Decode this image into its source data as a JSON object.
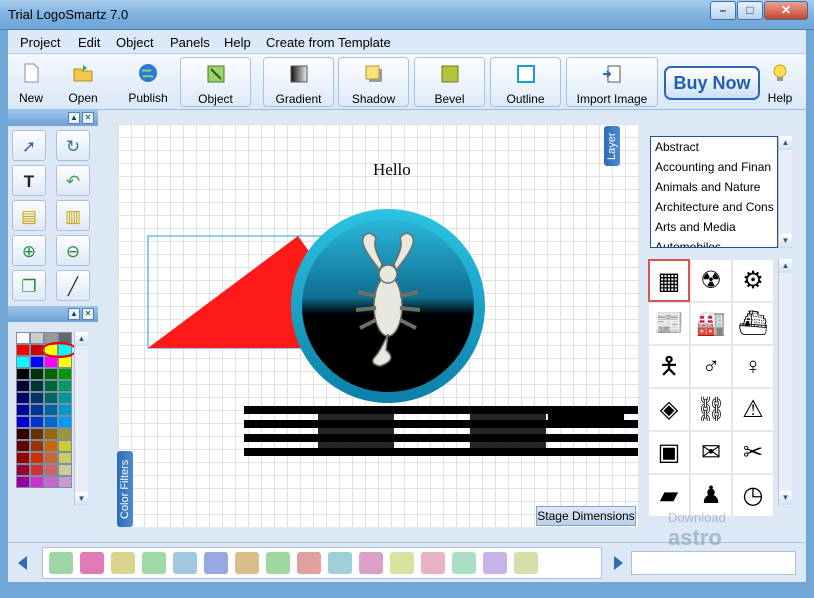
{
  "window": {
    "title": "Trial LogoSmartz 7.0",
    "buttons": [
      "–",
      "□",
      "✕"
    ]
  },
  "menu": [
    "Project",
    "Edit",
    "Object",
    "Panels",
    "Help",
    "Create from Template"
  ],
  "toolbar": {
    "new": "New",
    "open": "Open",
    "publish": "Publish",
    "object": "Object",
    "gradient": "Gradient",
    "shadow": "Shadow",
    "bevel": "Bevel",
    "outline": "Outline",
    "import_image": "Import Image",
    "buy_now": "Buy Now",
    "help": "Help"
  },
  "left_tools": [
    "select-arrow",
    "redo",
    "text",
    "undo",
    "bring-front",
    "send-back",
    "zoom-in",
    "zoom-out",
    "copy",
    "line"
  ],
  "canvas": {
    "hello": "Hello",
    "tabs": {
      "layer": "Layer",
      "color_filters": "Color Filters",
      "stage_dimensions": "Stage Dimensions"
    }
  },
  "categories": [
    "Abstract",
    "Accounting and Finan",
    "Animals and Nature",
    "Architecture and Cons",
    "Arts and Media",
    "Automobiles"
  ],
  "watermark": {
    "line1": "Download",
    "line2": "astro"
  },
  "colors": {
    "accent": "#2e6bb6",
    "triangle": "#ff1a1a",
    "badge_outer": "#18a9c9",
    "palette": [
      "#ffffff",
      "#cccccc",
      "#999999",
      "#666666",
      "#ff0000",
      "#cc0000",
      "#ffff00",
      "#00ffff",
      "#00ffff",
      "#0000ff",
      "#ff00ff",
      "#ffff00",
      "#000000",
      "#003300",
      "#006600",
      "#009900",
      "#000033",
      "#003333",
      "#006633",
      "#009966",
      "#000066",
      "#003366",
      "#006666",
      "#009999",
      "#000099",
      "#003399",
      "#006699",
      "#0099cc",
      "#0000cc",
      "#0033cc",
      "#0066cc",
      "#0099ff",
      "#330000",
      "#663300",
      "#996600",
      "#999933",
      "#660000",
      "#993300",
      "#cc6600",
      "#cccc33",
      "#990000",
      "#cc3300",
      "#cc6633",
      "#cccc66",
      "#990033",
      "#cc3333",
      "#cc6666",
      "#cccc99",
      "#990099",
      "#cc33cc",
      "#cc66cc",
      "#cc99cc"
    ],
    "strip": [
      "#9ed7a5",
      "#e07bb5",
      "#d9d48a",
      "#9fd9a8",
      "#9fc7e0",
      "#9aa7e3",
      "#d9c08a",
      "#9fd9a0",
      "#e0a0a0",
      "#9fd0d9",
      "#d9a0c8",
      "#d9e3a0",
      "#e7b3c3",
      "#a8e0c7",
      "#c7b3e7",
      "#d3e0a8"
    ]
  }
}
